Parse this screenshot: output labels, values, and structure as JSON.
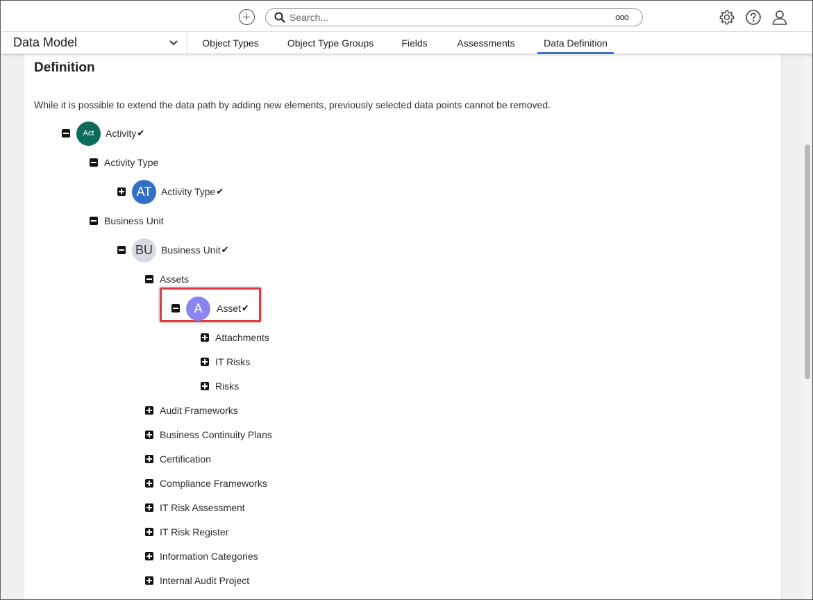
{
  "topbar": {
    "add_icon": "plus-circle-icon",
    "search": {
      "placeholder": "Search...",
      "options_label": "ooo"
    },
    "icons": [
      "gear-icon",
      "help-icon",
      "user-icon"
    ]
  },
  "navbar": {
    "module_label": "Data Model",
    "tabs": [
      {
        "label": "Object Types",
        "active": false
      },
      {
        "label": "Object Type Groups",
        "active": false
      },
      {
        "label": "Fields",
        "active": false
      },
      {
        "label": "Assessments",
        "active": false
      },
      {
        "label": "Data Definition",
        "active": true
      }
    ],
    "accent_color": "#3a6fc4"
  },
  "definition": {
    "title": "Definition",
    "note": "While it is possible to extend the data path by adding new elements, previously selected data points cannot be removed."
  },
  "tree": {
    "activity": {
      "avatar": "Act",
      "label": "Activity",
      "avatar_color": "#0d6b5e"
    },
    "activity_type_rel": {
      "label": "Activity Type"
    },
    "activity_type": {
      "avatar": "AT",
      "label": "Activity Type",
      "avatar_color": "#2f6fc6"
    },
    "business_unit_rel": {
      "label": "Business Unit"
    },
    "business_unit": {
      "avatar": "BU",
      "label": "Business Unit",
      "avatar_color": "#d6dbe3"
    },
    "assets_rel": {
      "label": "Assets"
    },
    "asset": {
      "avatar": "A",
      "label": "Asset",
      "avatar_color": "#8b86ef",
      "highlighted": true
    },
    "asset_children": [
      "Attachments",
      "IT Risks",
      "Risks"
    ],
    "bu_children": [
      "Audit Frameworks",
      "Business Continuity Plans",
      "Certification",
      "Compliance Frameworks",
      "IT Risk Assessment",
      "IT Risk Register",
      "Information Categories",
      "Internal Audit Project"
    ],
    "check_glyph": "✔",
    "highlight_color": "#e0393e"
  }
}
